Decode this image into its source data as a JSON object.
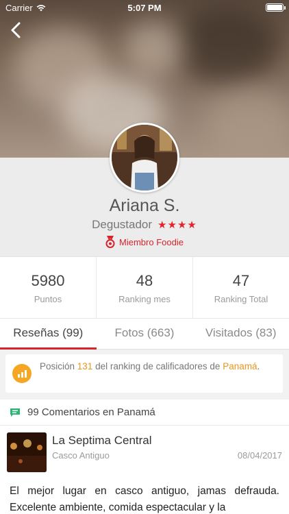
{
  "status_bar": {
    "carrier": "Carrier",
    "time": "5:07 PM"
  },
  "profile": {
    "name": "Ariana S.",
    "rank_label": "Degustador",
    "stars": "★★★★",
    "member_badge": "Miembro Foodie"
  },
  "stats": [
    {
      "value": "5980",
      "label": "Puntos"
    },
    {
      "value": "48",
      "label": "Ranking mes"
    },
    {
      "value": "47",
      "label": "Ranking Total"
    }
  ],
  "tabs": [
    {
      "label": "Reseñas (99)",
      "active": true
    },
    {
      "label": "Fotos (663)",
      "active": false
    },
    {
      "label": "Visitados (83)",
      "active": false
    }
  ],
  "ranking_banner": {
    "prefix": "Posición ",
    "position": "131",
    "middle": " del ranking de calificadores de ",
    "place": "Panamá",
    "suffix": "."
  },
  "comments_header": {
    "text": "99 Comentarios en Panamá"
  },
  "review": {
    "title": "La Septima Central",
    "location": "Casco Antiguo",
    "date": "08/04/2017",
    "body": "El mejor lugar en casco antiguo, jamas defrauda. Excelente ambiente, comida espectacular y la"
  },
  "colors": {
    "accent_red": "#d8232a",
    "accent_orange": "#f5a623",
    "comment_green": "#2bb673"
  },
  "icons": {
    "back": "chevron-left-icon",
    "member": "medal-icon",
    "banner": "bar-chart-icon",
    "comments": "chat-bubble-icon"
  }
}
